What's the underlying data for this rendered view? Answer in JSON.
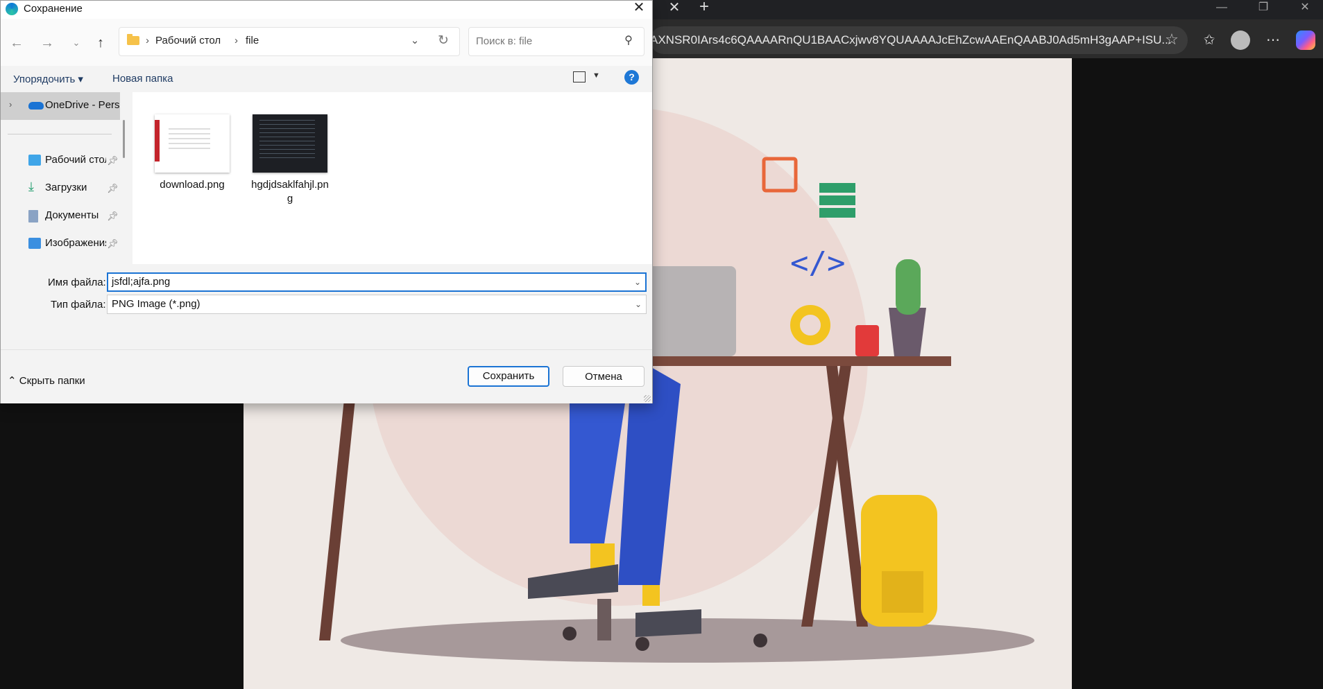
{
  "browser": {
    "address": "AXNSR0IArs4c6QAAAARnQU1BAACxjwv8YQUAAAAJcEhZcwAAEnQAABJ0Ad5mH3gAAP+ISU...",
    "tab_close": "✕",
    "new_tab": "+",
    "window_minimize": "—",
    "window_restore": "❐",
    "window_close": "✕"
  },
  "dialog": {
    "title": "Сохранение",
    "close": "✕",
    "path": {
      "crumbs": [
        "Рабочий стол",
        "file"
      ]
    },
    "search_placeholder": "Поиск в: file",
    "commands": {
      "organize": "Упорядочить ▾",
      "new_folder": "Новая папка",
      "help": "?"
    },
    "nav": {
      "onedrive": "OneDrive - Personal",
      "quick_access": [
        {
          "label": "Рабочий стол",
          "icon": "desktop-icon"
        },
        {
          "label": "Загрузки",
          "icon": "download-icon"
        },
        {
          "label": "Документы",
          "icon": "document-icon"
        },
        {
          "label": "Изображения",
          "icon": "image-icon"
        }
      ]
    },
    "files": [
      {
        "name": "download.png"
      },
      {
        "name": "hgdjdsaklfahjl.png"
      }
    ],
    "filename_label": "Имя файла:",
    "filename_value": "jsfdl;ajfa.png",
    "filetype_label": "Тип файла:",
    "filetype_value": "PNG Image (*.png)",
    "hide_folders": "Скрыть папки",
    "save_button": "Сохранить",
    "cancel_button": "Отмена"
  }
}
